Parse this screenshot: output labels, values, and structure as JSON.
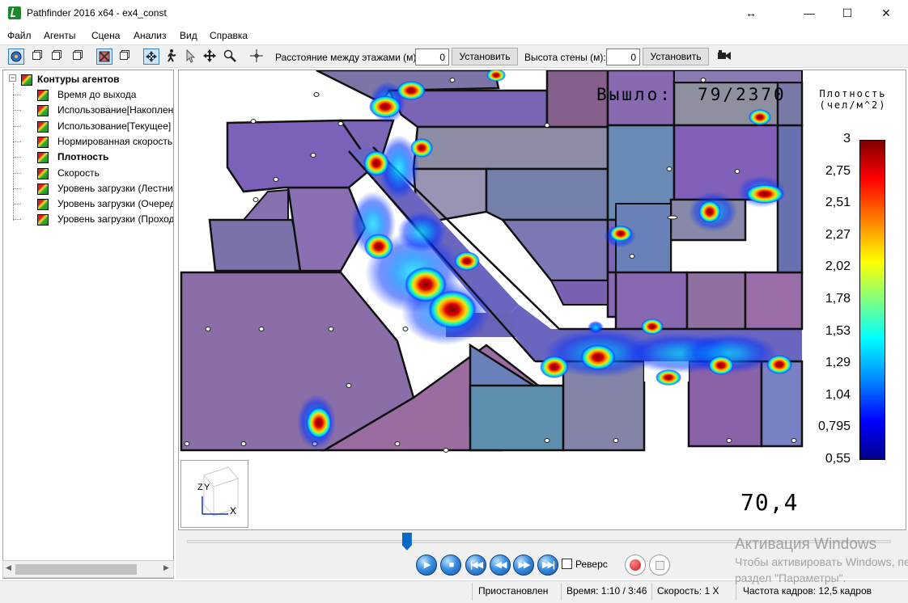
{
  "window": {
    "title": "Pathfinder 2016 x64 - ex4_const",
    "resize_glyph": "↔",
    "minimize_glyph": "—",
    "maximize_glyph": "☐",
    "close_glyph": "✕"
  },
  "menu": {
    "items": [
      "Файл",
      "Агенты",
      "Сцена",
      "Анализ",
      "Вид",
      "Справка"
    ]
  },
  "toolbar": {
    "floor_spacing_label": "Расстояние между этажами (м):",
    "floor_spacing_value": "0",
    "floor_spacing_apply": "Установить",
    "wall_height_label": "Высота стены (м):",
    "wall_height_value": "0",
    "wall_height_apply": "Установить",
    "icons": [
      "view-icon",
      "layers-icon",
      "layers-icon",
      "layers-icon",
      "hide-walls-icon",
      "layers-icon",
      "orbit-icon",
      "walk-icon",
      "select-icon",
      "pan-icon",
      "zoom-icon",
      "fit-icon",
      "camera-icon"
    ]
  },
  "tree": {
    "root": "Контуры агентов",
    "items": [
      "Время до выхода",
      "Использование[Накопленное]",
      "Использование[Текущее]",
      "Нормированная скорость",
      "Плотность",
      "Скорость",
      "Уровень загрузки (Лестницы)",
      "Уровень загрузки (Очереди)",
      "Уровень загрузки (Проходы)"
    ],
    "selected_index": 4
  },
  "viewport": {
    "exit_counter": "Вышло:  79/2370",
    "legend_title_line1": "Плотность",
    "legend_title_line2": "(чел/м^2)",
    "legend_ticks": [
      "3",
      "2,75",
      "2,51",
      "2,27",
      "2,02",
      "1,78",
      "1,53",
      "1,29",
      "1,04",
      "0,795",
      "0,55"
    ],
    "time_display": "70,4",
    "axis_z": "Z",
    "axis_y": "Y",
    "axis_x": "X"
  },
  "playback": {
    "position_fraction": 0.3125,
    "reverse_label": "Реверс",
    "reverse_checked": false
  },
  "status": {
    "state": "Приостановлен",
    "time": "Время: 1:10 / 3:46",
    "speed": "Скорость: 1 X",
    "fps": "Частота кадров: 12,5 кадров"
  },
  "watermark": {
    "title": "Активация Windows",
    "line1": "Чтобы активировать Windows, перейдите в",
    "line2": "раздел \"Параметры\"."
  },
  "colors": {
    "accent": "#0a68c8",
    "density_high": "#800000",
    "density_low": "#00008a"
  }
}
